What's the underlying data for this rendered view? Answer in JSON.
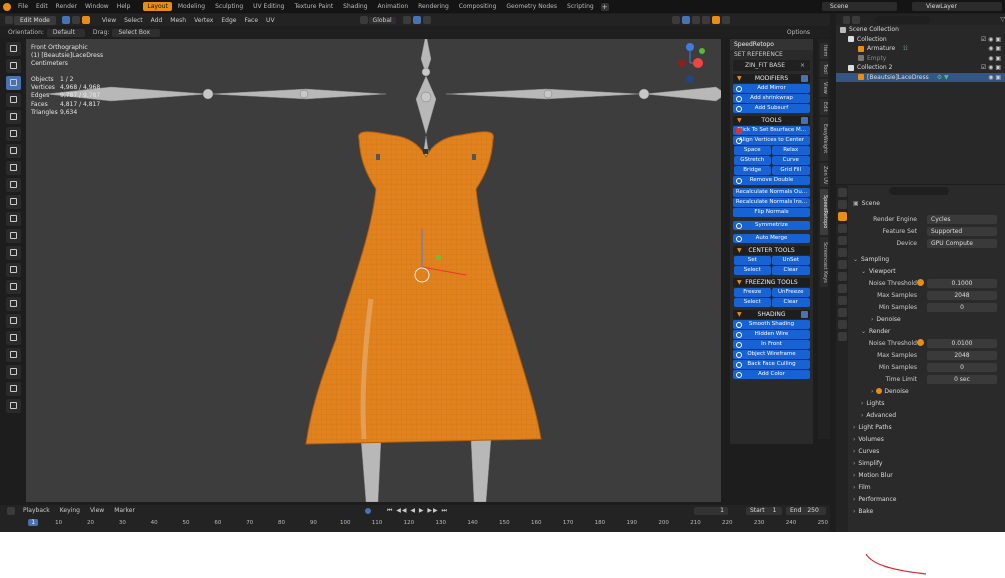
{
  "topbar": {
    "menus": [
      "File",
      "Edit",
      "Render",
      "Window",
      "Help"
    ],
    "workspaces": [
      "Layout",
      "Modeling",
      "Sculpting",
      "UV Editing",
      "Texture Paint",
      "Shading",
      "Animation",
      "Rendering",
      "Compositing",
      "Geometry Nodes",
      "Scripting"
    ],
    "active_workspace": "Layout",
    "scene": "Scene",
    "view_layer": "ViewLayer"
  },
  "viewport_header": {
    "mode": "Edit Mode",
    "menus": [
      "View",
      "Select",
      "Add",
      "Mesh",
      "Vertex",
      "Edge",
      "Face",
      "UV"
    ],
    "transform_orientation": "Global",
    "options_label": "Options"
  },
  "tool_header": {
    "orientation_label": "Orientation:",
    "orientation_value": "Default",
    "drag_label": "Drag:",
    "drag_value": "Select Box"
  },
  "viewport_info": {
    "view_name": "Front Orthographic",
    "object_name": "(1) [Beautsie]LaceDress",
    "units": "Centimeters"
  },
  "stats": [
    {
      "label": "Objects",
      "value": "1 / 2"
    },
    {
      "label": "Vertices",
      "value": "4,968 / 4,968"
    },
    {
      "label": "Edges",
      "value": "9,787 / 9,787"
    },
    {
      "label": "Faces",
      "value": "4,817 / 4,817"
    },
    {
      "label": "Triangles",
      "value": "9,634"
    }
  ],
  "speedretopo": {
    "title": "SpeedRetopo",
    "set_reference": "SET REFERENCE",
    "reference_object": "ZIN_FIT BASE",
    "modifiers_header": "MODIFIERS",
    "modifier_buttons": [
      "Add Mirror",
      "Add shrinkwrap",
      "Add Subsurf"
    ],
    "tools_header": "TOOLS",
    "bsurface_button": "Click To Set Bsurface M...",
    "align_button": "Align Vertices to Center",
    "space": "Space",
    "relax": "Relax",
    "gstretch": "GStretch",
    "curve": "Curve",
    "bridge": "Bridge",
    "gridfill": "Grid Fill",
    "remove_double": "Remove Double",
    "recalc_out": "Recalculate Normals Ou...",
    "recalc_in": "Recalculate Normals Ins...",
    "flip_normals": "Flip Normals",
    "symmetrize": "Symmetrize",
    "auto_merge": "Auto Merge",
    "center_tools_header": "CENTER TOOLS",
    "set": "Set",
    "unset": "UnSet",
    "select": "Select",
    "clear": "Clear",
    "freezing_header": "FREEZING TOOLS",
    "freeze": "Freeze",
    "unfreeze": "UnFreeze",
    "shading_header": "SHADING",
    "shading_buttons": [
      "Smooth Shading",
      "Hidden Wire",
      "In Front",
      "Object Wireframe",
      "Back Face Culling",
      "Add Color"
    ]
  },
  "side_tabs": [
    "Item",
    "Tool",
    "View",
    "Edit",
    "EasyWeight",
    "Zen UV",
    "SpeedRetopo",
    "Screencast Keys"
  ],
  "outliner": {
    "rows": [
      {
        "label": "Scene Collection",
        "indent": 0
      },
      {
        "label": "Collection",
        "indent": 1
      },
      {
        "label": "Armature",
        "indent": 2
      },
      {
        "label": "Empty",
        "indent": 2
      },
      {
        "label": "Collection 2",
        "indent": 1
      },
      {
        "label": "[Beautsie]LaceDress",
        "indent": 2
      }
    ]
  },
  "properties": {
    "scene_label": "Scene",
    "render_engine_label": "Render Engine",
    "render_engine": "Cycles",
    "feature_set_label": "Feature Set",
    "feature_set": "Supported",
    "device_label": "Device",
    "device": "GPU Compute",
    "sampling": "Sampling",
    "viewport": "Viewport",
    "noise_threshold_label": "Noise Threshold",
    "vp_noise_threshold": "0.1000",
    "max_samples_label": "Max Samples",
    "vp_max_samples": "2048",
    "min_samples_label": "Min Samples",
    "vp_min_samples": "0",
    "denoise": "Denoise",
    "render": "Render",
    "r_noise_threshold": "0.0100",
    "r_max_samples": "2048",
    "r_min_samples": "0",
    "time_limit_label": "Time Limit",
    "time_limit": "0 sec",
    "lights": "Lights",
    "advanced": "Advanced",
    "sections": [
      "Light Paths",
      "Volumes",
      "Curves",
      "Simplify",
      "Motion Blur",
      "Film",
      "Performance",
      "Bake"
    ]
  },
  "timeline": {
    "menus": [
      "Playback",
      "Keying",
      "View",
      "Marker"
    ],
    "current_frame": "1",
    "start_label": "Start",
    "start": "1",
    "end_label": "End",
    "end": "250",
    "ticks": [
      "10",
      "20",
      "30",
      "40",
      "50",
      "60",
      "70",
      "80",
      "90",
      "100",
      "110",
      "120",
      "130",
      "140",
      "150",
      "160",
      "170",
      "180",
      "190",
      "200",
      "210",
      "220",
      "230",
      "240",
      "250"
    ]
  },
  "colors": {
    "accent": "#e98e14",
    "selection_blue": "#4772b3",
    "button_blue": "#1763d3",
    "mesh_orange": "#e0821e"
  }
}
